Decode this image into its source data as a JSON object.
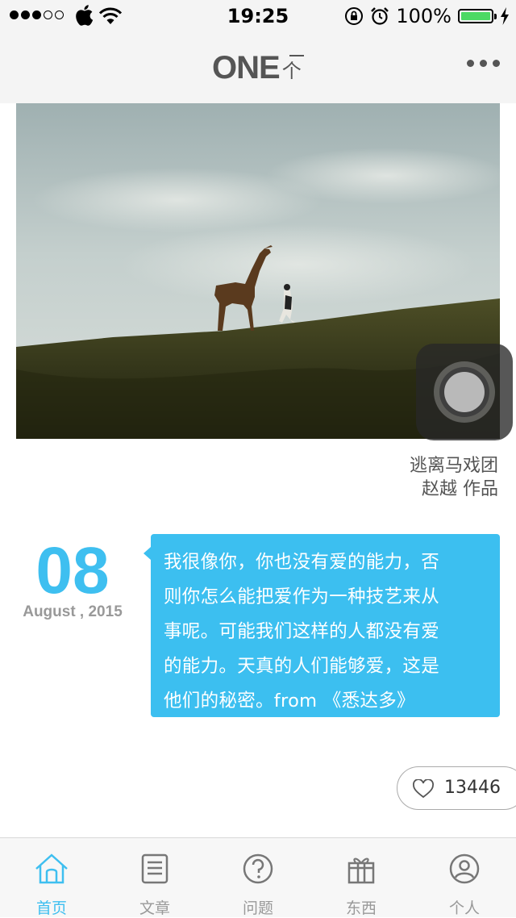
{
  "status_bar": {
    "time": "19:25",
    "battery": "100%"
  },
  "nav": {
    "logo": "ONE",
    "logo_cn": "个"
  },
  "photo": {
    "title": "逃离马戏团",
    "author": "赵越 作品"
  },
  "date": {
    "day": "08",
    "month_year": "August , 2015"
  },
  "quote": {
    "lines": [
      "我很像你，你也没有爱的能力，否",
      "则你怎么能把爱作为一种技艺来从",
      "事呢。可能我们这样的人都没有爱",
      "的能力。天真的人们能够爱，这是",
      "他们的秘密。from 《悉达多》"
    ]
  },
  "like": {
    "count": "13446"
  },
  "tabs": [
    {
      "label": "首页",
      "icon": "home-icon",
      "active": true
    },
    {
      "label": "文章",
      "icon": "article-icon",
      "active": false
    },
    {
      "label": "问题",
      "icon": "question-icon",
      "active": false
    },
    {
      "label": "东西",
      "icon": "gift-icon",
      "active": false
    },
    {
      "label": "个人",
      "icon": "user-icon",
      "active": false
    }
  ],
  "colors": {
    "accent": "#3ebff0",
    "battery": "#4cd964"
  }
}
